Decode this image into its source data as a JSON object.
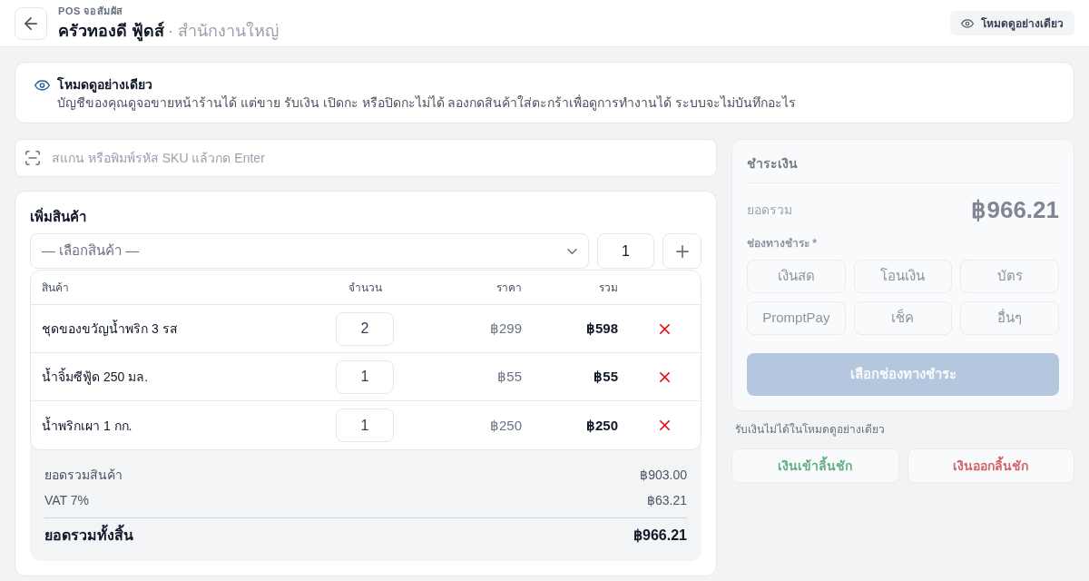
{
  "header": {
    "subtitle": "POS จอสัมผัส",
    "title": "ครัวทองดี ฟู้ดส์",
    "branch": "· สำนักงานใหญ่",
    "mode_button": "โหมดดูอย่างเดียว"
  },
  "notice": {
    "title": "โหมดดูอย่างเดียว",
    "message": "บัญชีของคุณดูจอขายหน้าร้านได้ แต่ขาย รับเงิน เปิดกะ หรือปิดกะไม่ได้ ลองกดสินค้าใส่ตะกร้าเพื่อดูการทำงานได้ ระบบจะไม่บันทึกอะไร"
  },
  "scan": {
    "placeholder": "สแกน หรือพิมพ์รหัส SKU แล้วกด Enter"
  },
  "add_product": {
    "title": "เพิ่มสินค้า",
    "select_placeholder": "— เลือกสินค้า —",
    "quantity": "1"
  },
  "cart": {
    "columns": [
      "สินค้า",
      "จำนวน",
      "ราคา",
      "รวม"
    ],
    "rows": [
      {
        "product": "ชุดของขวัญน้ำพริก 3 รส",
        "quantity": "2",
        "price": "฿299",
        "total": "฿598"
      },
      {
        "product": "น้ำจิ้มซีฟู้ด 250 มล.",
        "quantity": "1",
        "price": "฿55",
        "total": "฿55"
      },
      {
        "product": "น้ำพริกเผา 1 กก.",
        "quantity": "1",
        "price": "฿250",
        "total": "฿250"
      }
    ]
  },
  "summary": [
    {
      "kind": "line",
      "label": "ยอดรวมสินค้า",
      "value": "฿903.00"
    },
    {
      "kind": "line",
      "label": "VAT 7%",
      "value": "฿63.21"
    },
    {
      "kind": "total",
      "label": "ยอดรวมทั้งสิ้น",
      "value": "฿966.21"
    }
  ],
  "payment": {
    "title": "ชำระเงิน",
    "disabled": true,
    "total_label": "ยอดรวม",
    "total": "฿966.21",
    "methods_label": "ช่องทางชำระ *",
    "methods": [
      {
        "label": "เงินสด",
        "selected": false
      },
      {
        "label": "โอนเงิน",
        "selected": false
      },
      {
        "label": "บัตร",
        "selected": false
      },
      {
        "label": "PromptPay",
        "selected": false
      },
      {
        "label": "เช็ค",
        "selected": false
      },
      {
        "label": "อื่นๆ",
        "selected": false
      }
    ],
    "submit": {
      "label": "เลือกช่องทางชำระ",
      "disabled": true
    }
  },
  "cash_drawer": {
    "note": "รับเงินไม่ได้ในโหมดดูอย่างเดียว",
    "buttons": [
      {
        "kind": "in",
        "label": "เงินเข้าลิ้นชัก",
        "disabled": true
      },
      {
        "kind": "out",
        "label": "เงินออกลิ้นชัก",
        "disabled": true
      }
    ]
  }
}
